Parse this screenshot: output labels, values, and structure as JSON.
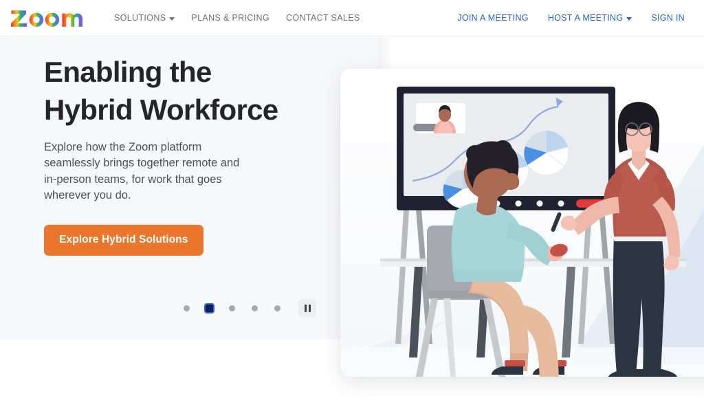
{
  "navbar": {
    "logo_alt": "Zoom",
    "left_items": [
      {
        "label": "SOLUTIONS",
        "has_caret": true
      },
      {
        "label": "PLANS & PRICING",
        "has_caret": false
      },
      {
        "label": "CONTACT SALES",
        "has_caret": false
      }
    ],
    "right_items": [
      {
        "label": "JOIN A MEETING",
        "has_caret": false
      },
      {
        "label": "HOST A MEETING",
        "has_caret": true
      },
      {
        "label": "SIGN IN",
        "has_caret": false
      }
    ]
  },
  "hero": {
    "title": "Enabling the Hybrid Workforce",
    "subtitle": "Explore how the Zoom platform seamlessly brings together remote and in-person teams, for work that goes wherever you do.",
    "cta_label": "Explore Hybrid Solutions",
    "carousel": {
      "slide_count": 5,
      "active_index": 2,
      "pause_label": "Pause"
    }
  },
  "colors": {
    "brand_blue": "#2d62c4",
    "cta_orange": "#e8762c",
    "hero_bg": "#f7f8f9",
    "heading": "#24252b",
    "body_text": "#4c4f54",
    "nav_text": "#6b7177",
    "dot_inactive": "#a6aab0",
    "dot_active": "#0b1f52"
  },
  "illustration": {
    "alt": "Two colleagues in a hybrid meeting room: a seated person at a desk and a standing presenter pointing at a large display showing a video-call participant, a line graph and pie charts",
    "elements": [
      "whiteboard-display",
      "video-call-inset",
      "line-graph",
      "pie-chart-1",
      "pie-chart-2",
      "pie-chart-3",
      "seated-person",
      "standing-presenter",
      "desk",
      "chair"
    ]
  }
}
